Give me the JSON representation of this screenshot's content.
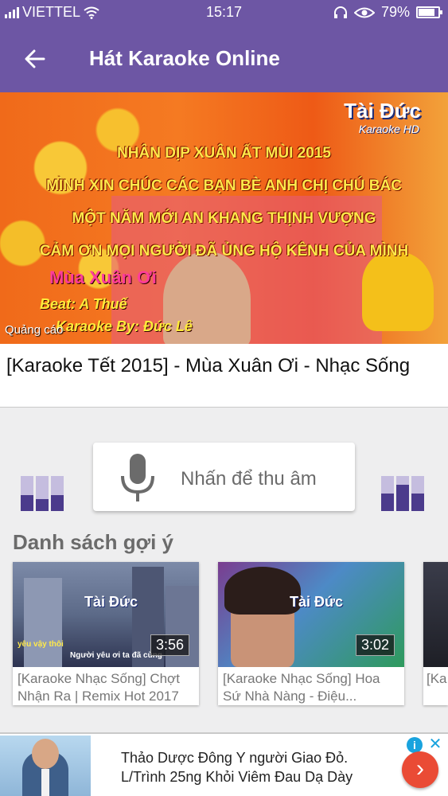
{
  "status_bar": {
    "carrier": "VIETTEL",
    "time": "15:17",
    "battery": "79%"
  },
  "app_bar": {
    "title": "Hát Karaoke Online"
  },
  "video": {
    "overlay_lines": [
      "NHÂN DỊP XUÂN ẤT MÙI 2015",
      "MÌNH XIN CHÚC CÁC BẠN BÈ ANH CHỊ CHÚ BÁC",
      "MỘT NĂM MỚI AN KHANG THỊNH VƯỢNG",
      "CẢM ƠN MỌI NGƯỜI ĐÃ ỦNG HỘ KÊNH CỦA MÌNH"
    ],
    "brand": "Tài Đức",
    "brand_sub": "Karaoke HD",
    "song_name": "Mùa Xuân Ơi",
    "beat": "Beat: A Thuế",
    "karaoke_by": "Karaoke By: Đức Lê",
    "ad_label": "Quảng cáo",
    "title": "[Karaoke Tết 2015] - Mùa Xuân Ơi - Nhạc Sống"
  },
  "recorder": {
    "label": "Nhấn để thu âm",
    "left_levels": [
      0.45,
      0.35,
      0.45
    ],
    "right_levels": [
      0.5,
      0.75,
      0.5
    ]
  },
  "suggestions": {
    "title": "Danh sách gợi ý",
    "items": [
      {
        "title": "[Karaoke Nhạc Sống] Chợt Nhận Ra | Remix Hot 2017",
        "duration": "3:56",
        "brand": "Tài Đức",
        "caption_1": "yêu vậy thôi",
        "caption_2": "Người yêu ơi ta đã cùng"
      },
      {
        "title": "[Karaoke Nhạc Sống] Hoa Sứ Nhà Nàng - Điệu...",
        "duration": "3:02",
        "brand": "Tài Đức",
        "caption_1": "",
        "caption_2": ""
      },
      {
        "title": "[Ka... Cà...",
        "duration": "",
        "brand": "",
        "caption_1": "",
        "caption_2": ""
      }
    ]
  },
  "ad": {
    "line1": "Thảo Dược Đông Y người Giao Đỏ.",
    "line2": "L/Trình 25ng Khỏi Viêm Đau Dạ Dày",
    "info_glyph": "i",
    "close_glyph": "✕",
    "go_glyph": "›"
  },
  "colors": {
    "primary": "#6d56a4",
    "bar_dark": "#4b3b8c",
    "bar_light": "#c5bddf",
    "ad_go": "#ea4b35",
    "ad_info": "#19a3de"
  }
}
